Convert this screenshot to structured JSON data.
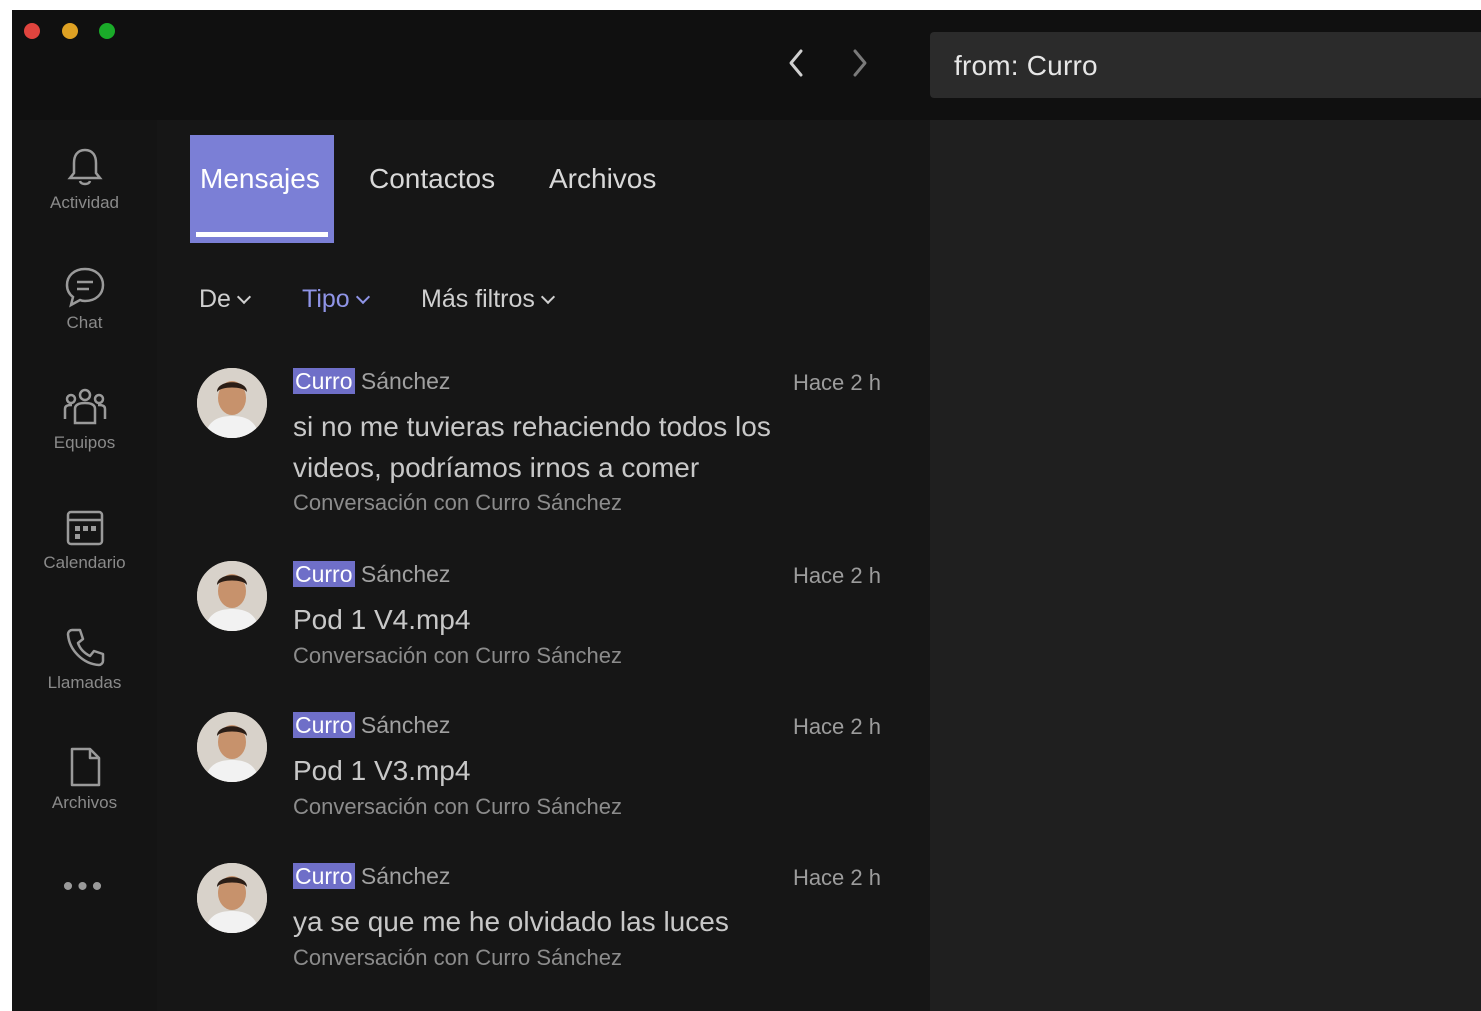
{
  "window_controls": {
    "close_color": "#e0443e",
    "minimize_color": "#dea123",
    "zoom_color": "#1aab29"
  },
  "header": {
    "back_icon": "chevron-left-icon",
    "forward_icon": "chevron-right-icon",
    "search_query": "from: Curro"
  },
  "rail": {
    "items": [
      {
        "label": "Actividad",
        "icon": "bell-icon"
      },
      {
        "label": "Chat",
        "icon": "chat-bubble-icon"
      },
      {
        "label": "Equipos",
        "icon": "teams-icon"
      },
      {
        "label": "Calendario",
        "icon": "calendar-icon"
      },
      {
        "label": "Llamadas",
        "icon": "phone-icon"
      },
      {
        "label": "Archivos",
        "icon": "file-icon"
      }
    ],
    "more_label": "•••"
  },
  "tabs": [
    {
      "label": "Mensajes",
      "active": true
    },
    {
      "label": "Contactos",
      "active": false
    },
    {
      "label": "Archivos",
      "active": false
    }
  ],
  "filters": [
    {
      "label": "De"
    },
    {
      "label": "Tipo"
    },
    {
      "label": "Más filtros"
    }
  ],
  "results": [
    {
      "sender_highlight": "Curro",
      "sender_rest": " Sánchez",
      "time": "Hace 2 h",
      "message": "si no me tuvieras rehaciendo todos los videos, podríamos irnos a comer",
      "conversation": "Conversación con Curro Sánchez"
    },
    {
      "sender_highlight": "Curro",
      "sender_rest": " Sánchez",
      "time": "Hace 2 h",
      "message": "Pod 1 V4.mp4",
      "conversation": "Conversación con Curro Sánchez"
    },
    {
      "sender_highlight": "Curro",
      "sender_rest": " Sánchez",
      "time": "Hace 2 h",
      "message": "Pod 1 V3.mp4",
      "conversation": "Conversación con Curro Sánchez"
    },
    {
      "sender_highlight": "Curro",
      "sender_rest": " Sánchez",
      "time": "Hace 2 h",
      "message": "ya se que me he olvidado las luces",
      "conversation": "Conversación con Curro Sánchez"
    }
  ],
  "colors": {
    "accent": "#7b7fd6",
    "highlight": "#6f6fc8"
  }
}
